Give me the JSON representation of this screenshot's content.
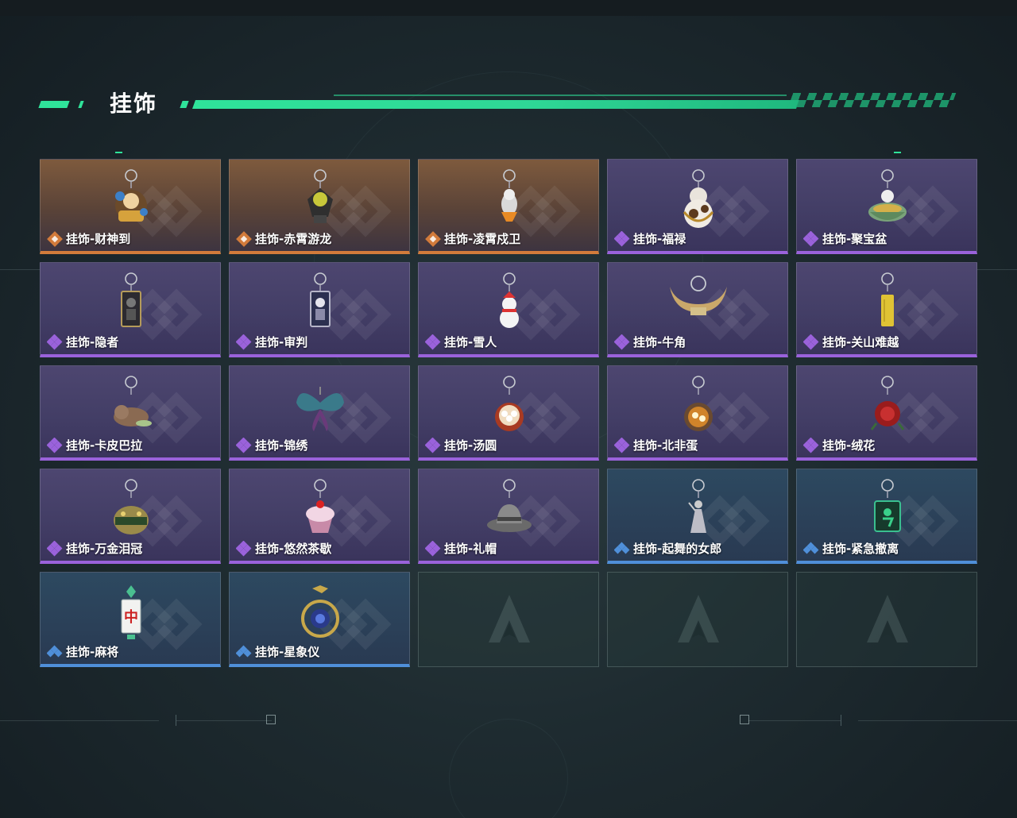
{
  "section": {
    "title": "挂饰"
  },
  "colors": {
    "accent": "#2fe39a",
    "legendary": "#d27b3b",
    "epic": "#9a62db",
    "rare": "#4f8fd9"
  },
  "items": [
    {
      "name": "挂饰-财神到",
      "rarity": "legendary",
      "icon": "god-of-wealth-charm-icon"
    },
    {
      "name": "挂饰-赤霄游龙",
      "rarity": "legendary",
      "icon": "dragon-figure-charm-icon"
    },
    {
      "name": "挂饰-凌霄戍卫",
      "rarity": "legendary",
      "icon": "guardian-figure-charm-icon"
    },
    {
      "name": "挂饰-福禄",
      "rarity": "epic",
      "icon": "gourd-charm-icon"
    },
    {
      "name": "挂饰-聚宝盆",
      "rarity": "epic",
      "icon": "treasure-bowl-charm-icon"
    },
    {
      "name": "挂饰-隐者",
      "rarity": "epic",
      "icon": "hermit-tarot-charm-icon"
    },
    {
      "name": "挂饰-审判",
      "rarity": "epic",
      "icon": "judgement-tarot-charm-icon"
    },
    {
      "name": "挂饰-雪人",
      "rarity": "epic",
      "icon": "snowman-charm-icon"
    },
    {
      "name": "挂饰-牛角",
      "rarity": "epic",
      "icon": "bull-horn-charm-icon"
    },
    {
      "name": "挂饰-关山难越",
      "rarity": "epic",
      "icon": "gold-bar-charm-icon"
    },
    {
      "name": "挂饰-卡皮巴拉",
      "rarity": "epic",
      "icon": "capybara-charm-icon"
    },
    {
      "name": "挂饰-锦绣",
      "rarity": "epic",
      "icon": "butterfly-charm-icon"
    },
    {
      "name": "挂饰-汤圆",
      "rarity": "epic",
      "icon": "dumpling-bowl-charm-icon"
    },
    {
      "name": "挂饰-北非蛋",
      "rarity": "epic",
      "icon": "shakshuka-charm-icon"
    },
    {
      "name": "挂饰-绒花",
      "rarity": "epic",
      "icon": "red-flower-charm-icon"
    },
    {
      "name": "挂饰-万金泪冠",
      "rarity": "epic",
      "icon": "crown-charm-icon"
    },
    {
      "name": "挂饰-悠然茶歇",
      "rarity": "epic",
      "icon": "cupcake-charm-icon"
    },
    {
      "name": "挂饰-礼帽",
      "rarity": "epic",
      "icon": "fedora-charm-icon"
    },
    {
      "name": "挂饰-起舞的女郎",
      "rarity": "rare",
      "icon": "dancer-charm-icon"
    },
    {
      "name": "挂饰-紧急撤离",
      "rarity": "rare",
      "icon": "exit-sign-charm-icon"
    },
    {
      "name": "挂饰-麻将",
      "rarity": "rare",
      "icon": "mahjong-tile-charm-icon"
    },
    {
      "name": "挂饰-星象仪",
      "rarity": "rare",
      "icon": "astrolabe-charm-icon"
    }
  ],
  "empty_slots": 3
}
